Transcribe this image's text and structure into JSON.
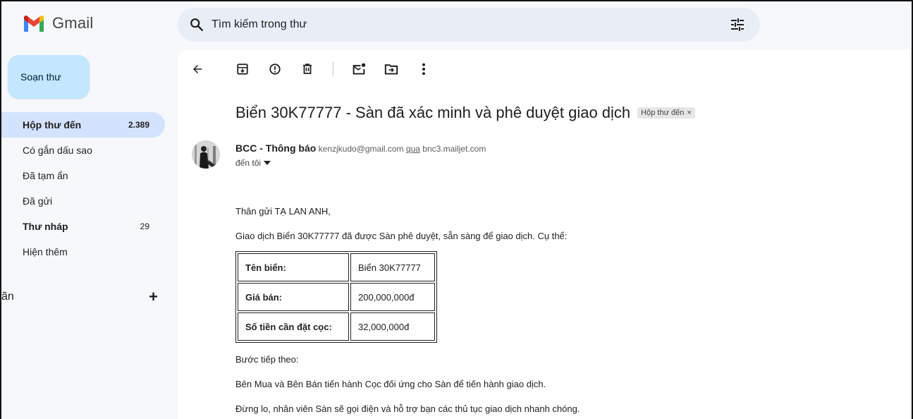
{
  "app": {
    "name": "Gmail",
    "brand_colors": {
      "red": "#ea4335",
      "blue": "#4285f4",
      "green": "#34a853",
      "yellow": "#fbbc04"
    }
  },
  "search": {
    "placeholder": "Tìm kiếm trong thư",
    "icon": "search-icon",
    "options_icon": "tune-icon"
  },
  "sidebar": {
    "compose_label": "Soạn thư",
    "items": [
      {
        "label": "Hộp thư đến",
        "count": "2.389",
        "active": true
      },
      {
        "label": "Có gắn dấu sao",
        "count": ""
      },
      {
        "label": "Đã tạm ẩn",
        "count": ""
      },
      {
        "label": "Đã gửi",
        "count": ""
      },
      {
        "label": "Thư nháp",
        "count": "29",
        "bold": true
      },
      {
        "label": "Hiện thêm",
        "count": ""
      }
    ],
    "labels_header": "ãn",
    "labels_add": "+"
  },
  "toolbar": {
    "icons": [
      "back-arrow-icon",
      "archive-icon",
      "report-spam-icon",
      "delete-icon",
      "mark-unread-icon",
      "move-to-icon",
      "more-options-icon"
    ]
  },
  "email": {
    "subject": "Biển 30K77777 - Sàn đã xác minh và phê duyệt giao dịch",
    "tag": "Hộp thư đến",
    "tag_close": "×",
    "sender_name": "BCC - Thông báo",
    "sender_email": "kenzjkudo@gmail.com",
    "via_label": "qua",
    "via_domain": "bnc3.mailjet.com",
    "to_label": "đến tôi",
    "greeting": "Thân gửi TẠ LAN ANH,",
    "intro": "Giao dịch Biển 30K77777 đã được Sàn phê duyệt, sẵn sàng để giao dịch. Cụ thể:",
    "table": [
      {
        "key": "Tên biển:",
        "value": "Biển 30K77777"
      },
      {
        "key": "Giá bán:",
        "value": "200,000,000đ"
      },
      {
        "key": "Số tiền cần đặt cọc:",
        "value": "32,000,000đ"
      }
    ],
    "next_step": "Bước tiếp theo:",
    "instruction": "Bên Mua và Bên Bán tiến hành Cọc đối ứng cho Sàn để tiến hành giao dịch.",
    "reassurance": "Đừng lo, nhân viên Sàn sẽ gọi điện và hỗ trợ bạn các thủ tục giao dịch nhanh chóng."
  }
}
